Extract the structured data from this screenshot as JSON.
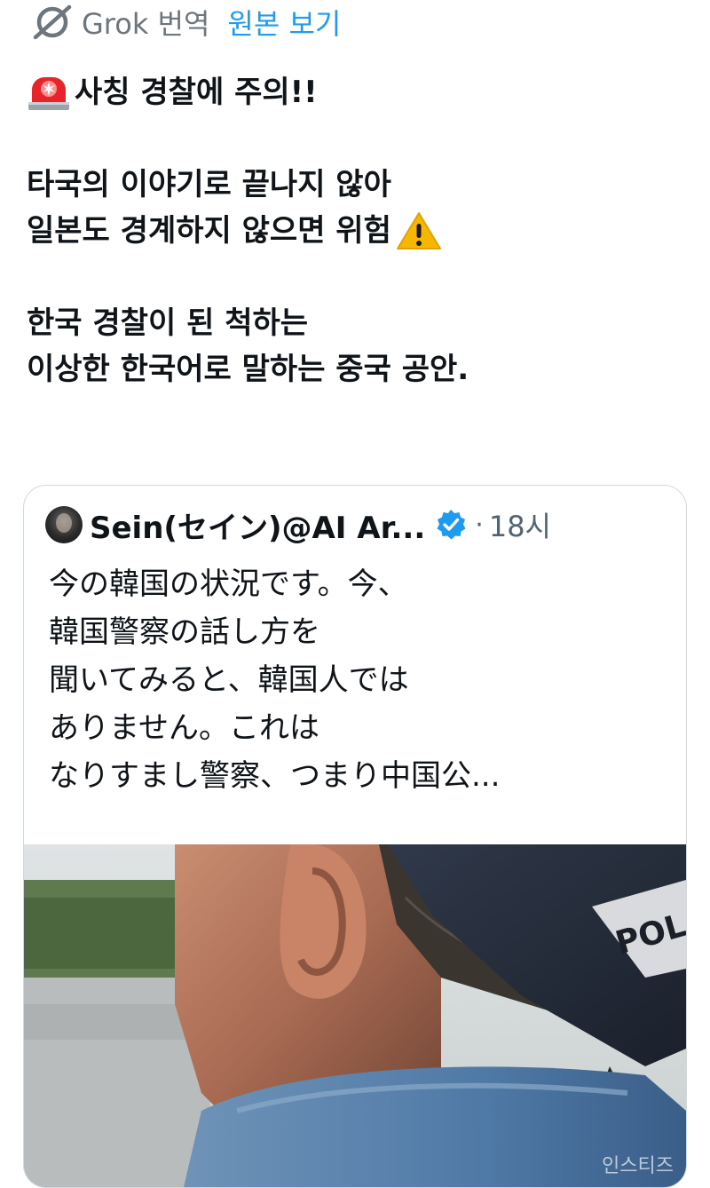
{
  "translation_bar": {
    "grok_label": "Grok 번역",
    "view_original": "원본 보기",
    "icon": "grok-icon"
  },
  "post": {
    "lines": [
      "사칭 경찰에 주의!!",
      "타국의 이야기로 끝나지 않아",
      "일본도 경계하지 않으면 위험",
      "한국 경찰이 된 척하는",
      "이상한 한국어로 말하는 중국 공안."
    ],
    "emoji": {
      "line1_prefix": "police-siren-emoji",
      "line3_suffix": "warning-emoji"
    }
  },
  "quote": {
    "author": "Sein(セイン)@AI Ar...",
    "verified": true,
    "separator": "·",
    "time": "18시",
    "text_lines": [
      "今の韓国の状況です。今、",
      "韓国警察の話し方を",
      "聞いてみると、韓国人では",
      "ありません。これは",
      "なりすまし警察、つまり中国公..."
    ],
    "media": {
      "cap_text": "POL",
      "watermark": "인스티즈"
    }
  },
  "colors": {
    "link": "#1d9bf0",
    "muted": "#536471",
    "border": "#cfd9de",
    "text": "#0f1419"
  }
}
